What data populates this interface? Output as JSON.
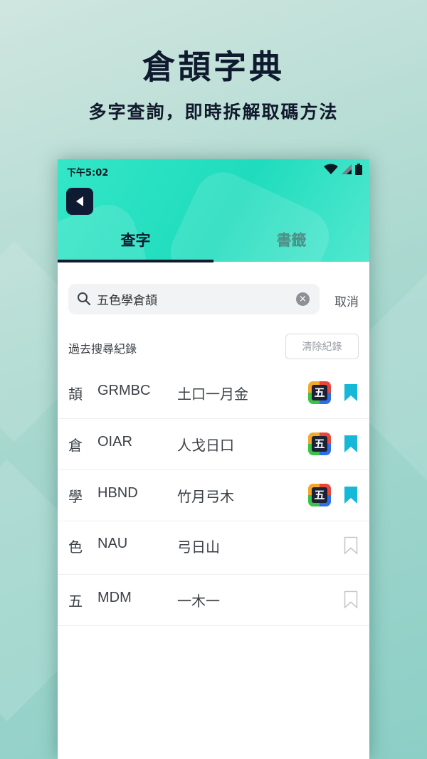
{
  "promo": {
    "title": "倉頡字典",
    "subtitle": "多字查詢，即時拆解取碼方法"
  },
  "status_bar": {
    "time": "下午5:02",
    "icons": [
      "wifi-icon",
      "signal-icon",
      "battery-icon"
    ]
  },
  "tabs": [
    {
      "label": "查字",
      "active": true
    },
    {
      "label": "書籤",
      "active": false
    }
  ],
  "search": {
    "value": "五色學倉頡",
    "cancel_label": "取消"
  },
  "history": {
    "label": "過去搜尋紀錄",
    "clear_label": "清除紀錄"
  },
  "results": [
    {
      "char": "頡",
      "code": "GRMBC",
      "roots": "土口一月金",
      "has_badge": true,
      "bookmarked": true
    },
    {
      "char": "倉",
      "code": "OIAR",
      "roots": "人戈日口",
      "has_badge": true,
      "bookmarked": true
    },
    {
      "char": "學",
      "code": "HBND",
      "roots": "竹月弓木",
      "has_badge": true,
      "bookmarked": true
    },
    {
      "char": "色",
      "code": "NAU",
      "roots": "弓日山",
      "has_badge": false,
      "bookmarked": false
    },
    {
      "char": "五",
      "code": "MDM",
      "roots": "一木一",
      "has_badge": false,
      "bookmarked": false
    }
  ],
  "badge_label": "五",
  "colors": {
    "accent": "#1fdcbd",
    "bookmark_active": "#16b8d8",
    "bookmark_inactive": "#c5c9cd",
    "dark": "#0f1a2e"
  }
}
